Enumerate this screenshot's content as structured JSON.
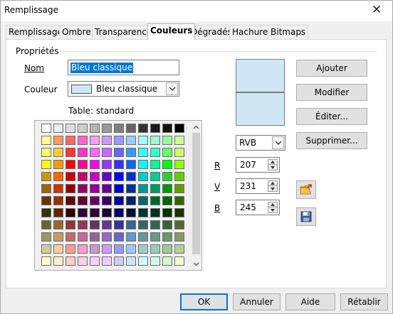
{
  "window": {
    "title": "Remplissage"
  },
  "tabs": [
    {
      "label": "Remplissage"
    },
    {
      "label": "Ombre"
    },
    {
      "label": "Transparence"
    },
    {
      "label": "Couleurs",
      "active": true
    },
    {
      "label": "Dégradés"
    },
    {
      "label": "Hachure"
    },
    {
      "label": "Bitmaps"
    }
  ],
  "properties": {
    "group_title": "Propriétés",
    "name_label": "Nom",
    "name_value": "Bleu classique",
    "color_label": "Couleur",
    "color_value": "Bleu classique",
    "table_label": "Table: standard",
    "selected_color": "#cfe7f5"
  },
  "palette": {
    "rows": [
      [
        "#ffffff",
        "#eeeeee",
        "#dddddd",
        "#cccccc",
        "#b3b3b3",
        "#999999",
        "#808080",
        "#666666",
        "#333333",
        "#1c1c1c",
        "#111111",
        "#000000"
      ],
      [
        "#ffff99",
        "#ff9966",
        "#ff6666",
        "#ff66cc",
        "#ff99ff",
        "#cc99ff",
        "#9999ff",
        "#99ccff",
        "#99ffff",
        "#99ffcc",
        "#99ff99",
        "#ccff99"
      ],
      [
        "#ffff66",
        "#ffcc33",
        "#ff3333",
        "#ff33cc",
        "#ff66ff",
        "#cc66ff",
        "#6666ff",
        "#3399ff",
        "#33ffff",
        "#33ffcc",
        "#66ff66",
        "#ccff66"
      ],
      [
        "#ffff00",
        "#ff9900",
        "#ff0000",
        "#ff0099",
        "#ff00ff",
        "#9933ff",
        "#3333ff",
        "#0066ff",
        "#00ffff",
        "#00ff99",
        "#00ff00",
        "#99ff00"
      ],
      [
        "#cc9900",
        "#ff6600",
        "#cc0000",
        "#cc0066",
        "#cc00cc",
        "#6600cc",
        "#0000ff",
        "#0033cc",
        "#00cccc",
        "#00cc99",
        "#33cc33",
        "#66cc00"
      ],
      [
        "#996600",
        "#cc3300",
        "#990000",
        "#990066",
        "#990099",
        "#660099",
        "#0000cc",
        "#003399",
        "#009999",
        "#009966",
        "#009900",
        "#669900"
      ],
      [
        "#663300",
        "#993300",
        "#660000",
        "#660033",
        "#660066",
        "#330066",
        "#000099",
        "#002266",
        "#006666",
        "#006633",
        "#006600",
        "#336600"
      ],
      [
        "#333300",
        "#662200",
        "#330000",
        "#330033",
        "#330033",
        "#1a0033",
        "#000066",
        "#001133",
        "#003333",
        "#003322",
        "#003300",
        "#1a3300"
      ],
      [
        "#666633",
        "#996633",
        "#993333",
        "#993366",
        "#663366",
        "#663399",
        "#333399",
        "#336699",
        "#336666",
        "#336655",
        "#336633",
        "#556633"
      ],
      [
        "#999966",
        "#cc9966",
        "#cc6666",
        "#cc6699",
        "#996699",
        "#9966cc",
        "#6666cc",
        "#6699cc",
        "#669999",
        "#669988",
        "#669966",
        "#889966"
      ],
      [
        "#cccc99",
        "#ffcc99",
        "#ff9999",
        "#ff99cc",
        "#cc99cc",
        "#cc99ff",
        "#9999ff",
        "#99ccff",
        "#99cccc",
        "#99ccbb",
        "#99cc99",
        "#bbcc99"
      ],
      [
        "#ffffcc",
        "#ffeecc",
        "#ffcccc",
        "#ffccee",
        "#ffccff",
        "#eeccff",
        "#ccccff",
        "#cce6ff",
        "#ccffff",
        "#ccffee",
        "#ccffcc",
        "#eeffcc"
      ]
    ]
  },
  "mode_select": {
    "value": "RVB"
  },
  "rgb": {
    "r_label": "R",
    "r_value": "207",
    "v_label": "V",
    "v_value": "231",
    "b_label": "B",
    "b_value": "245"
  },
  "actions": {
    "ajouter": "Ajouter",
    "modifier": "Modifier",
    "editer": "Éditer...",
    "supprimer": "Supprimer..."
  },
  "icons": {
    "load": "open-folder-icon",
    "save": "save-disk-icon"
  },
  "footer": {
    "ok": "OK",
    "annuler": "Annuler",
    "aide": "Aide",
    "retablir": "Rétablir"
  }
}
